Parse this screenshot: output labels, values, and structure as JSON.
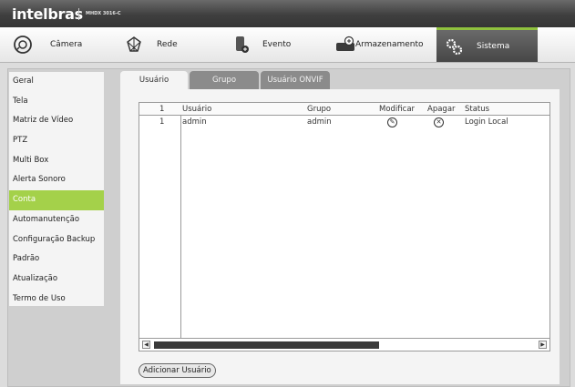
{
  "header": {
    "brand": "intelbras",
    "model": "MHDX 3016-C"
  },
  "topnav": [
    {
      "label": "Câmera",
      "icon": "camera-icon"
    },
    {
      "label": "Rede",
      "icon": "network-icon"
    },
    {
      "label": "Evento",
      "icon": "event-icon"
    },
    {
      "label": "Armazenamento",
      "icon": "storage-icon"
    },
    {
      "label": "Sistema",
      "icon": "gear-icon",
      "active": true
    }
  ],
  "sidebar": {
    "items": [
      {
        "label": "Geral"
      },
      {
        "label": "Tela"
      },
      {
        "label": "Matriz de Vídeo"
      },
      {
        "label": "PTZ"
      },
      {
        "label": "Multi Box"
      },
      {
        "label": "Alerta Sonoro"
      },
      {
        "label": "Conta",
        "active": true
      },
      {
        "label": "Automanutenção"
      },
      {
        "label": "Configuração Backup"
      },
      {
        "label": "Padrão"
      },
      {
        "label": "Atualização"
      },
      {
        "label": "Termo de Uso"
      }
    ]
  },
  "tabs": [
    {
      "label": "Usuário",
      "active": true
    },
    {
      "label": "Grupo"
    },
    {
      "label": "Usuário ONVIF"
    }
  ],
  "table": {
    "header": {
      "index": "1",
      "user": "Usuário",
      "group": "Grupo",
      "modify": "Modificar",
      "delete": "Apagar",
      "status": "Status"
    },
    "rows": [
      {
        "index": "1",
        "user": "admin",
        "group": "admin",
        "status": "Login Local"
      }
    ]
  },
  "actions": {
    "add_user_label": "Adicionar Usuário"
  },
  "colors": {
    "accent": "#a4d14a",
    "header_dark": "#3f3f3f"
  }
}
